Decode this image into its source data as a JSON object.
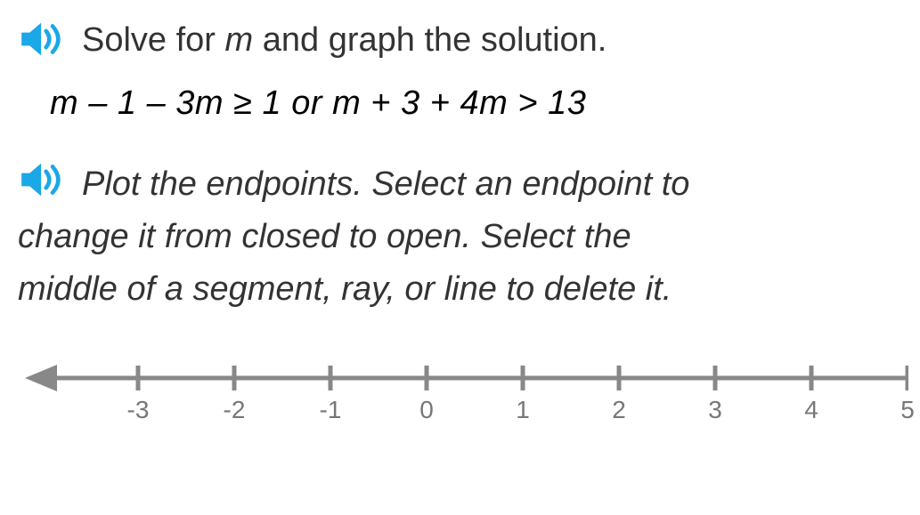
{
  "question": {
    "prefix": "Solve for ",
    "variable": "m",
    "suffix": " and graph the solution."
  },
  "equation": "m – 1 – 3m ≥ 1 or m + 3 + 4m > 13",
  "instructions": {
    "line1": "Plot the endpoints. Select an endpoint to",
    "line2": "change it from closed to open. Select the",
    "line3": "middle of a segment, ray, or line to delete it."
  },
  "chart_data": {
    "type": "numberline",
    "min": -3,
    "max": 5,
    "ticks": [
      -3,
      -2,
      -1,
      0,
      1,
      2,
      3,
      4,
      5
    ],
    "arrow_left": true,
    "arrow_right": false,
    "tick_color": "#888",
    "line_color": "#888"
  },
  "icons": {
    "speaker": "speaker-icon"
  }
}
